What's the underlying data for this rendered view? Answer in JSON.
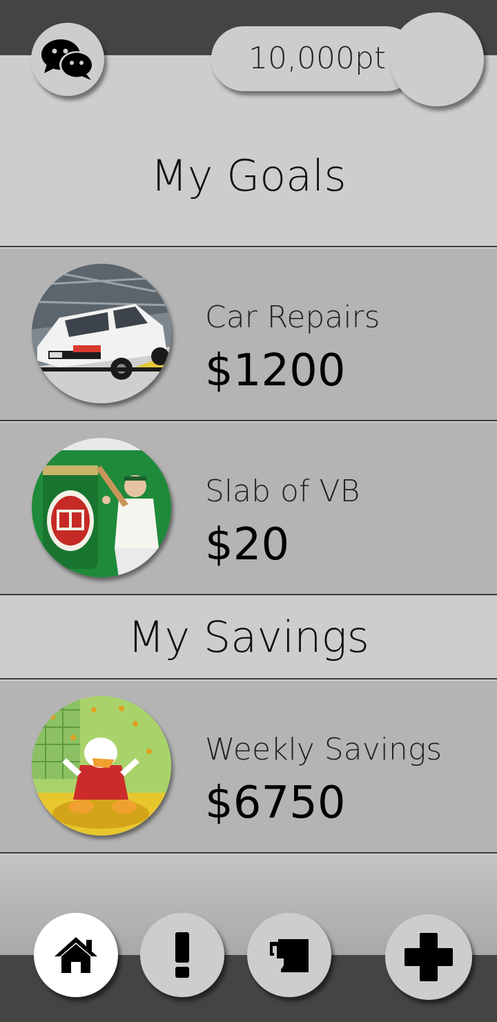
{
  "header": {
    "points": "10,000pt",
    "chat_icon": "chat-bubbles-icon",
    "avatar_icon": "profile-avatar"
  },
  "goals": {
    "title": "My Goals",
    "items": [
      {
        "label": "Car Repairs",
        "amount": "$1200",
        "image": "car-thumbnail"
      },
      {
        "label": "Slab of VB",
        "amount": "$20",
        "image": "beer-thumbnail"
      }
    ]
  },
  "savings": {
    "title": "My Savings",
    "items": [
      {
        "label": "Weekly Savings",
        "amount": "$6750",
        "image": "coins-thumbnail"
      }
    ]
  },
  "nav": {
    "items": [
      {
        "icon": "home-icon",
        "active": true
      },
      {
        "icon": "alert-icon",
        "active": false
      },
      {
        "icon": "trophy-icon",
        "active": false
      },
      {
        "icon": "plus-icon",
        "active": false
      }
    ]
  },
  "colors": {
    "dark_bar": "#444444",
    "panel": "#cdcdcd",
    "card": "#b4b4b4",
    "text": "#111111"
  }
}
